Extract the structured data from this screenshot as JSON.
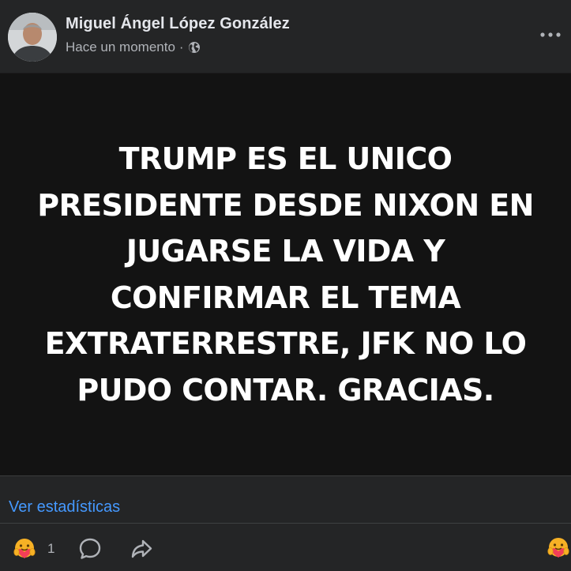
{
  "post": {
    "author_name": "Miguel Ángel López González",
    "timestamp": "Hace un momento",
    "separator": "·",
    "audience_icon": "globe-icon",
    "menu_icon": "more-horizontal-icon",
    "text_lines": [
      "TRUMP ES EL UNICO",
      "PRESIDENTE DESDE NIXON EN",
      "JUGARSE LA VIDA Y",
      "CONFIRMAR EL TEMA",
      "EXTRATERRESTRE, JFK NO LO",
      "PUDO CONTAR. GRACIAS."
    ]
  },
  "footer": {
    "stats_link": "Ver estadísticas",
    "reaction_count": "1",
    "reaction_icon": "care-emoji-icon",
    "comment_icon": "comment-bubble-icon",
    "share_icon": "share-arrow-icon",
    "react_icon": "care-emoji-icon"
  },
  "colors": {
    "background": "#242526",
    "media_background": "#131313",
    "link": "#4599ff",
    "secondary_text": "#b0b3b8",
    "primary_text": "#e4e6eb"
  }
}
